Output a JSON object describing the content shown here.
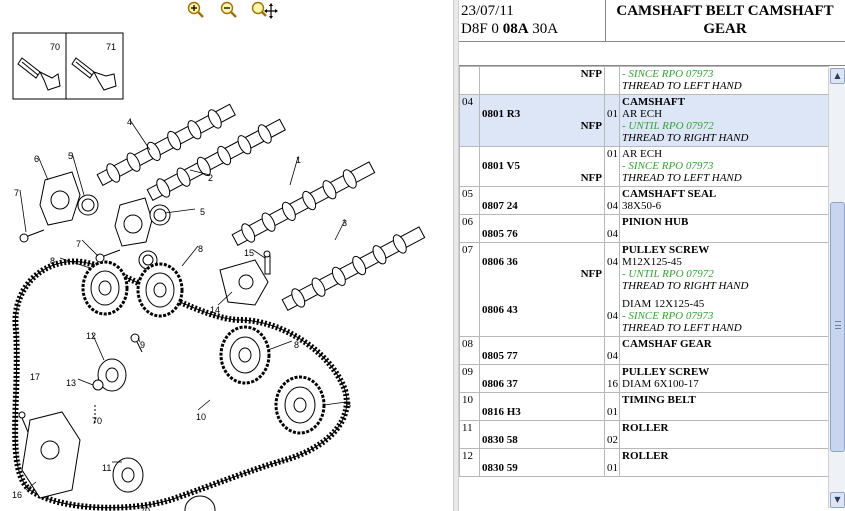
{
  "toolbar": {
    "zoom_in_icon": "magnify-plus-icon",
    "zoom_out_icon": "magnify-minus-icon",
    "zoom_move_icon": "magnify-move-icon"
  },
  "diagram": {
    "callouts": [
      "70",
      "71",
      "4",
      "6",
      "5",
      "2",
      "1",
      "7",
      "5",
      "7",
      "3",
      "8",
      "8",
      "15",
      "14",
      "9",
      "12",
      "8",
      "13",
      "10",
      "8",
      "17",
      "70",
      "11",
      "16",
      "70"
    ]
  },
  "header": {
    "date": "23/07/11",
    "code_prefix": "D8F 0 ",
    "code_bold": "08A",
    "code_suffix": " 30A",
    "title": "CAMSHAFT BELT CAMSHAFT GEAR"
  },
  "rows": [
    {
      "pos": "",
      "ref": "",
      "nfp": "NFP",
      "qty": "",
      "title": "",
      "lines": [],
      "notes": [
        {
          "type": "green",
          "text": "- SINCE RPO 07973"
        },
        {
          "type": "it",
          "text": "THREAD TO LEFT HAND"
        }
      ],
      "selected": false
    },
    {
      "pos": "04",
      "ref": "0801 R3",
      "nfp": "NFP",
      "qty": "01",
      "title": "CAMSHAFT",
      "lines": [
        "AR ECH"
      ],
      "notes": [
        {
          "type": "green",
          "text": "- UNTIL RPO 07972"
        },
        {
          "type": "it",
          "text": "THREAD TO RIGHT HAND"
        }
      ],
      "selected": true
    },
    {
      "pos": "",
      "ref": "0801 V5",
      "nfp": "NFP",
      "qty": "01",
      "title": "",
      "lines": [
        "AR ECH"
      ],
      "notes": [
        {
          "type": "green",
          "text": "- SINCE RPO 07973"
        },
        {
          "type": "it",
          "text": "THREAD TO LEFT HAND"
        }
      ],
      "selected": false
    },
    {
      "pos": "05",
      "ref": "0807 24",
      "nfp": "",
      "qty": "04",
      "title": "CAMSHAFT SEAL",
      "lines": [
        "38X50-6"
      ],
      "notes": [],
      "selected": false
    },
    {
      "pos": "06",
      "ref": "0805 76",
      "nfp": "",
      "qty": "04",
      "title": "PINION HUB",
      "lines": [],
      "notes": [],
      "selected": false
    },
    {
      "pos": "07",
      "ref": "0806 36",
      "nfp": "NFP",
      "qty": "04",
      "title": "PULLEY SCREW",
      "lines": [
        "M12X125-45"
      ],
      "notes": [
        {
          "type": "green",
          "text": "- UNTIL RPO 07972"
        },
        {
          "type": "it",
          "text": "THREAD TO RIGHT HAND"
        }
      ],
      "selected": false,
      "sub": {
        "ref": "0806 43",
        "qty": "04",
        "lines": [
          "DIAM 12X125-45"
        ],
        "notes": [
          {
            "type": "green",
            "text": "- SINCE RPO 07973"
          },
          {
            "type": "it",
            "text": "THREAD TO LEFT HAND"
          }
        ]
      }
    },
    {
      "pos": "08",
      "ref": "0805 77",
      "nfp": "",
      "qty": "04",
      "title": "CAMSHAF GEAR",
      "lines": [],
      "notes": [],
      "selected": false
    },
    {
      "pos": "09",
      "ref": "0806 37",
      "nfp": "",
      "qty": "16",
      "title": "PULLEY SCREW",
      "lines": [
        "DIAM 6X100-17"
      ],
      "notes": [],
      "selected": false
    },
    {
      "pos": "10",
      "ref": "0816 H3",
      "nfp": "",
      "qty": "01",
      "title": "TIMING BELT",
      "lines": [],
      "notes": [],
      "selected": false
    },
    {
      "pos": "11",
      "ref": "0830 58",
      "nfp": "",
      "qty": "02",
      "title": "ROLLER",
      "lines": [],
      "notes": [],
      "selected": false
    },
    {
      "pos": "12",
      "ref": "0830 59",
      "nfp": "",
      "qty": "01",
      "title": "ROLLER",
      "lines": [],
      "notes": [],
      "selected": false
    }
  ],
  "scrollbar": {
    "up_icon": "arrow-up-icon",
    "down_icon": "arrow-down-icon",
    "up_glyph": "▲",
    "down_glyph": "▼"
  }
}
